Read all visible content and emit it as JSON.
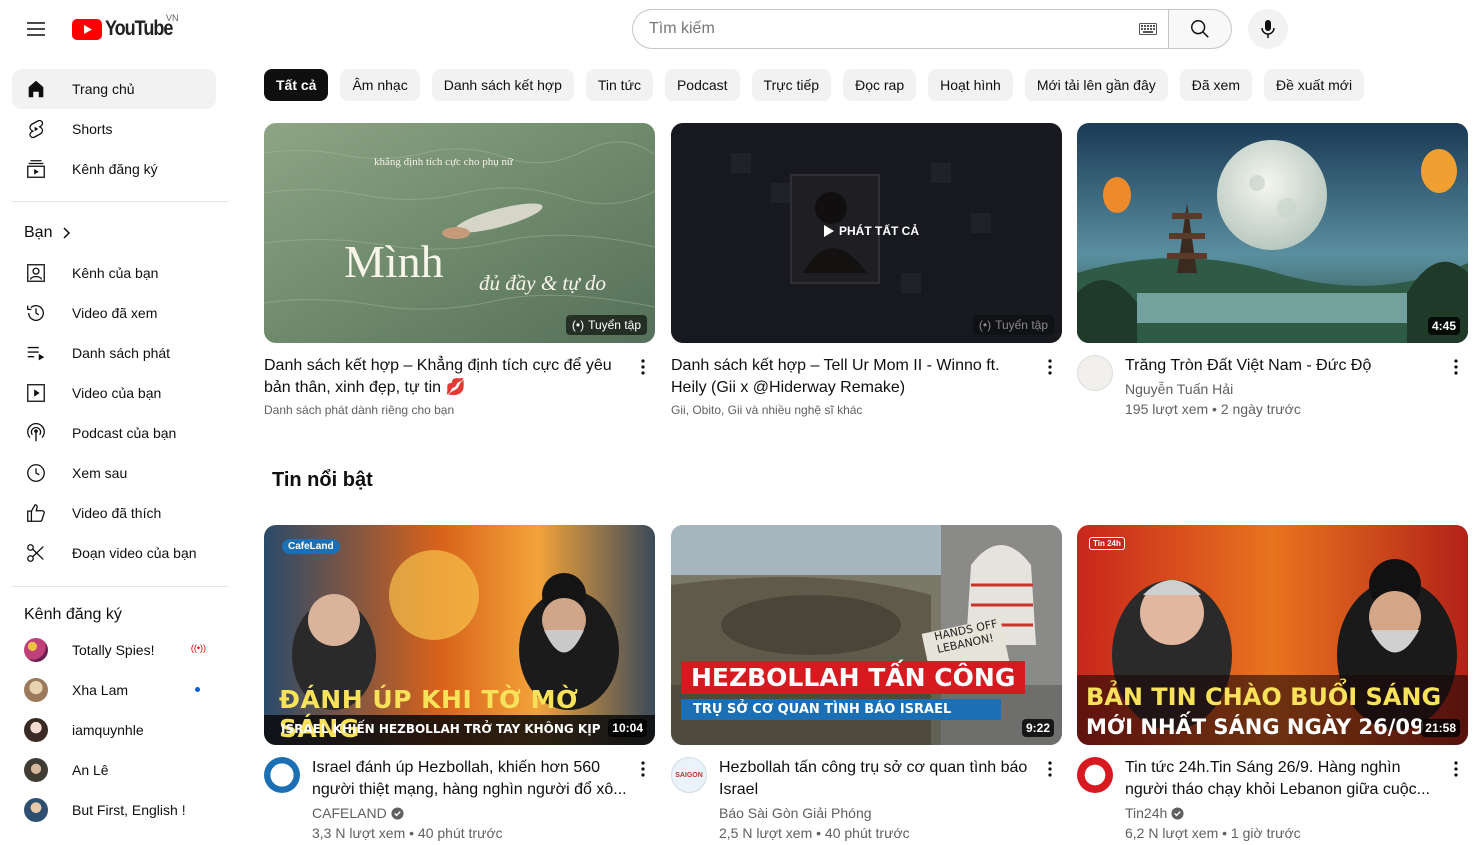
{
  "header": {
    "logo_text": "YouTube",
    "country_code": "VN",
    "search_placeholder": "Tìm kiếm"
  },
  "sidebar": {
    "main": [
      {
        "label": "Trang chủ",
        "icon": "home-icon",
        "active": true
      },
      {
        "label": "Shorts",
        "icon": "shorts-icon"
      },
      {
        "label": "Kênh đăng ký",
        "icon": "subscriptions-icon"
      }
    ],
    "you_heading": "Bạn",
    "you": [
      {
        "label": "Kênh của bạn",
        "icon": "your-channel-icon"
      },
      {
        "label": "Video đã xem",
        "icon": "history-icon"
      },
      {
        "label": "Danh sách phát",
        "icon": "playlists-icon"
      },
      {
        "label": "Video của bạn",
        "icon": "your-videos-icon"
      },
      {
        "label": "Podcast của bạn",
        "icon": "podcast-icon"
      },
      {
        "label": "Xem sau",
        "icon": "watch-later-icon"
      },
      {
        "label": "Video đã thích",
        "icon": "liked-icon"
      },
      {
        "label": "Đoạn video của bạn",
        "icon": "clips-icon"
      }
    ],
    "subs_heading": "Kênh đăng ký",
    "subscriptions": [
      {
        "label": "Totally Spies!",
        "indicator": "live",
        "avatar_color": "#a04a7a"
      },
      {
        "label": "Xha Lam",
        "indicator": "dot",
        "avatar_color": "#d9c3a5"
      },
      {
        "label": "iamquynhle",
        "avatar_color": "#c9a898"
      },
      {
        "label": "An Lê",
        "avatar_color": "#5c5a52"
      },
      {
        "label": "But First, English !",
        "avatar_color": "#4d6b8a"
      }
    ]
  },
  "chips": [
    "Tất cả",
    "Âm nhạc",
    "Danh sách kết hợp",
    "Tin tức",
    "Podcast",
    "Trực tiếp",
    "Đọc rap",
    "Hoạt hình",
    "Mới tải lên gần đây",
    "Đã xem",
    "Đề xuất mới"
  ],
  "row1": [
    {
      "title": "Danh sách kết hợp – Khẳng định tích cực để yêu bản thân, xinh đẹp, tự tin 💋",
      "subtitle": "Danh sách phát dành riêng cho bạn",
      "badge": "Tuyển tập",
      "thumb_caption_small": "khẳng định tích cực cho phụ nữ",
      "thumb_caption_big": "Mình",
      "thumb_caption_script": "đủ đầy & tự do"
    },
    {
      "title": "Danh sách kết hợp – Tell Ur Mom II - Winno ft. Heily (Gii x @Hiderway Remake)",
      "subtitle": "Gii, Obito, Gii và nhiều nghệ sĩ khác",
      "badge": "Tuyển tập",
      "play_all": "PHÁT TẤT CẢ"
    },
    {
      "title": "Trăng Tròn Đất Việt Nam - Đức Độ",
      "channel": "Nguyễn Tuấn Hải",
      "stats": "195 lượt xem • 2 ngày trước",
      "duration": "4:45"
    }
  ],
  "section_title": "Tin nổi bật",
  "row2": [
    {
      "title": "Israel đánh úp Hezbollah, khiến hơn 560 người thiệt mạng, hàng nghìn người đổ xô...",
      "channel": "CAFELAND",
      "verified": true,
      "stats": "3,3 N lượt xem • 40 phút trước",
      "duration": "10:04",
      "thumb_headline": "ĐÁNH ÚP KHI TỜ MỜ SÁNG",
      "thumb_sub": "ISRAEL KHIẾN HEZBOLLAH TRỞ TAY KHÔNG KỊP",
      "thumb_logo": "CafeLand"
    },
    {
      "title": "Hezbollah tấn công trụ sở cơ quan tình báo Israel",
      "channel": "Báo Sài Gòn Giải Phóng",
      "stats": "2,5 N lượt xem • 40 phút trước",
      "duration": "9:22",
      "thumb_headline": "HEZBOLLAH TẤN CÔNG",
      "thumb_sub": "TRỤ SỞ CƠ QUAN TÌNH BÁO ISRAEL",
      "thumb_sign": "HANDS OFF LEBANON!",
      "avatar_text": "SAIGON"
    },
    {
      "title": "Tin tức 24h.Tin Sáng 26/9. Hàng nghìn người tháo chạy khỏi Lebanon giữa cuộc...",
      "channel": "Tin24h",
      "verified": true,
      "stats": "6,2 N lượt xem • 1 giờ trước",
      "duration": "21:58",
      "thumb_headline": "BẢN TIN CHÀO BUỔI SÁNG",
      "thumb_sub": "MỚI NHẤT SÁNG NGÀY 26/09",
      "thumb_logo": "Tin 24h"
    }
  ]
}
